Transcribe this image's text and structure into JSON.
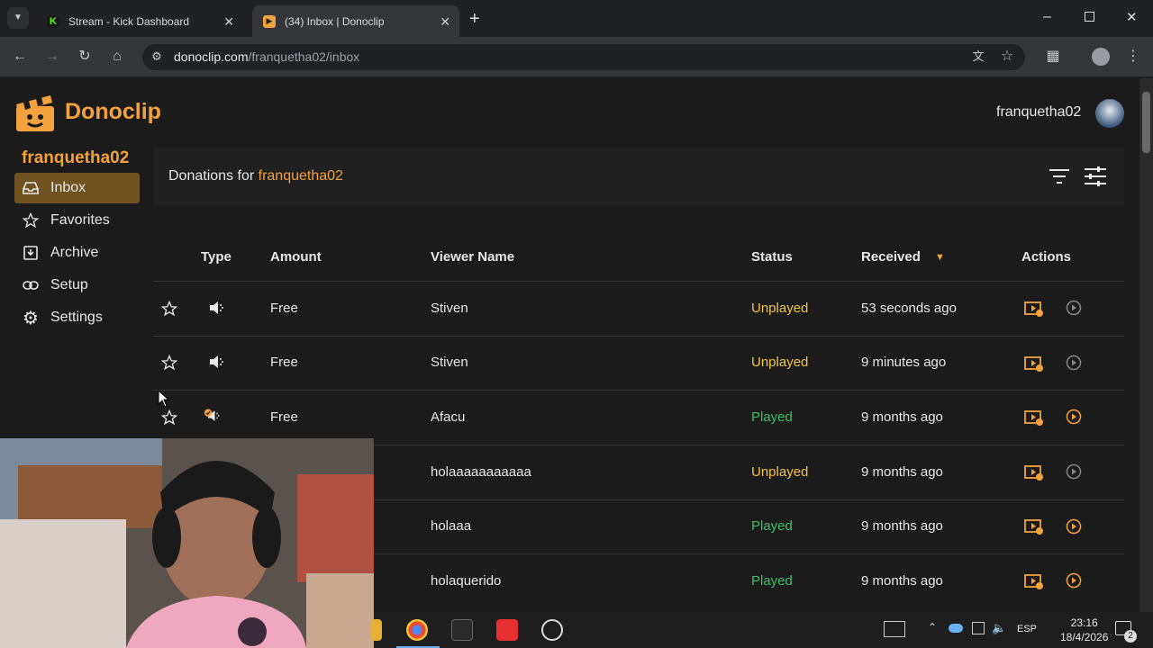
{
  "browser": {
    "tabs": [
      {
        "title": "Stream - Kick Dashboard",
        "icon": "kick-icon"
      },
      {
        "title": "(34) Inbox | Donoclip",
        "icon": "donoclip-icon"
      }
    ],
    "url_domain": "donoclip.com",
    "url_path": "/franquetha02/inbox"
  },
  "app": {
    "brand": "Donoclip",
    "username": "franquetha02"
  },
  "sidebar": {
    "title": "franquetha02",
    "items": [
      {
        "label": "Inbox",
        "icon": "inbox-icon",
        "active": true
      },
      {
        "label": "Favorites",
        "icon": "star-icon"
      },
      {
        "label": "Archive",
        "icon": "archive-icon"
      },
      {
        "label": "Setup",
        "icon": "link-icon"
      },
      {
        "label": "Settings",
        "icon": "gear-icon"
      }
    ]
  },
  "panel": {
    "prefix": "Donations for",
    "user": "franquetha02"
  },
  "table": {
    "headers": {
      "type": "Type",
      "amount": "Amount",
      "viewer": "Viewer Name",
      "status": "Status",
      "received": "Received",
      "actions": "Actions"
    },
    "rows": [
      {
        "amount": "Free",
        "viewer": "Stiven",
        "status": "Unplayed",
        "received": "53 seconds ago"
      },
      {
        "amount": "Free",
        "viewer": "Stiven",
        "status": "Unplayed",
        "received": "9 minutes ago"
      },
      {
        "amount": "Free",
        "viewer": "Afacu",
        "status": "Played",
        "received": "9 months ago"
      },
      {
        "amount": "",
        "viewer": "holaaaaaaaaaaa",
        "status": "Unplayed",
        "received": "9 months ago"
      },
      {
        "amount": "",
        "viewer": "holaaa",
        "status": "Played",
        "received": "9 months ago"
      },
      {
        "amount": "",
        "viewer": "holaquerido",
        "status": "Played",
        "received": "9 months ago"
      }
    ]
  },
  "taskbar": {
    "lang": "ESP",
    "time": "23:16",
    "date": "18/4/2026",
    "notifications": "2"
  },
  "colors": {
    "accent": "#f4a23d",
    "unplayed": "#f4c542",
    "played": "#3fbf6a"
  }
}
